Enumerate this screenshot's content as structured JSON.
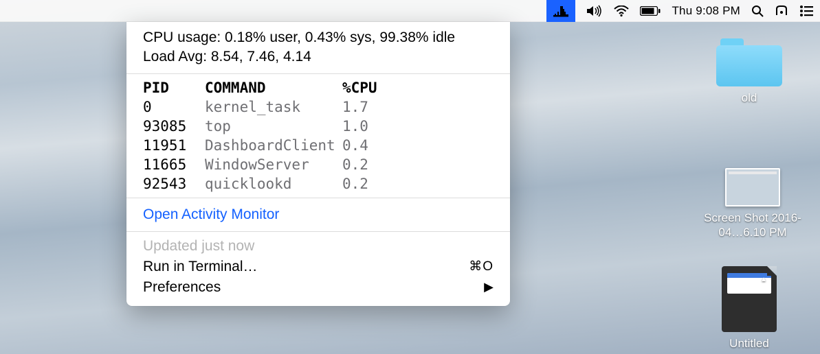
{
  "menubar": {
    "clock": "Thu 9:08 PM"
  },
  "panel": {
    "cpuLine": "CPU usage: 0.18% user, 0.43% sys, 99.38% idle",
    "loadLine": "Load Avg: 8.54, 7.46, 4.14",
    "headers": {
      "pid": "PID",
      "cmd": "COMMAND",
      "cpu": "%CPU"
    },
    "rows": [
      {
        "pid": "0",
        "cmd": "kernel_task",
        "cpu": "1.7"
      },
      {
        "pid": "93085",
        "cmd": "top",
        "cpu": "1.0"
      },
      {
        "pid": "11951",
        "cmd": "DashboardClient",
        "cpu": "0.4"
      },
      {
        "pid": "11665",
        "cmd": "WindowServer",
        "cpu": "0.2"
      },
      {
        "pid": "92543",
        "cmd": "quicklookd",
        "cpu": "0.2"
      }
    ],
    "openActivity": "Open Activity Monitor",
    "updated": "Updated just now",
    "runTerminal": "Run in Terminal…",
    "runShortcut": "⌘O",
    "prefs": "Preferences",
    "prefsArrow": "▶"
  },
  "desktop": {
    "folder": "old",
    "screenshot": "Screen Shot 2016-04…6.10 PM",
    "sdcard": "Untitled"
  }
}
